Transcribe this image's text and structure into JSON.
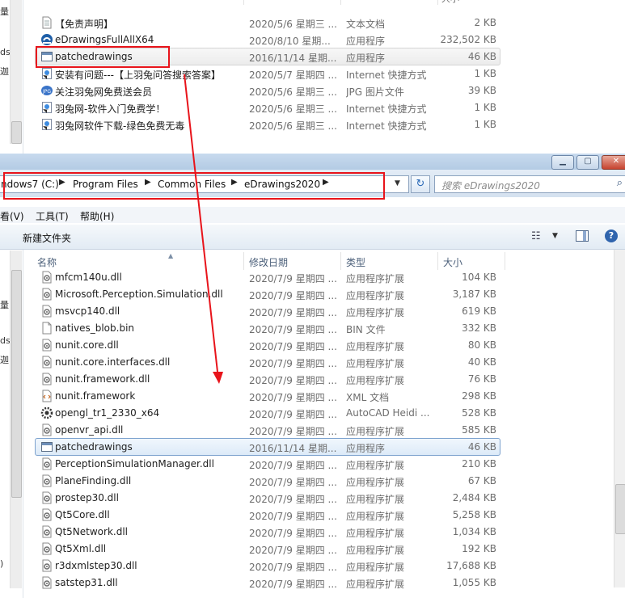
{
  "top_window": {
    "left_frag_lines": [
      "量",
      "ds",
      "迦"
    ],
    "column_header_frags": [
      "",
      "",
      "大小"
    ],
    "files": [
      {
        "name": "【免责声明】",
        "date": "2020/5/6 星期三 ...",
        "type": "文本文档",
        "size": "2 KB",
        "icon": "text-file-icon"
      },
      {
        "name": "eDrawingsFullAllX64",
        "date": "2020/8/10 星期...",
        "type": "应用程序",
        "size": "232,502 KB",
        "icon": "edrawings-app-icon"
      },
      {
        "name": "patchedrawings",
        "date": "2016/11/14 星期...",
        "type": "应用程序",
        "size": "46 KB",
        "icon": "application-icon"
      },
      {
        "name": "安装有问题---【上羽兔问答搜索答案】",
        "date": "2020/5/7 星期四 ...",
        "type": "Internet 快捷方式",
        "size": "1 KB",
        "icon": "internet-shortcut-icon"
      },
      {
        "name": "关注羽兔网免费送会员",
        "date": "2020/5/6 星期三 ...",
        "type": "JPG 图片文件",
        "size": "39 KB",
        "icon": "jpg-file-icon"
      },
      {
        "name": "羽兔网-软件入门免费学！",
        "date": "2020/5/6 星期三 ...",
        "type": "Internet 快捷方式",
        "size": "1 KB",
        "icon": "internet-shortcut-icon"
      },
      {
        "name": "羽兔网软件下载-绿色免费无毒",
        "date": "2020/5/6 星期三 ...",
        "type": "Internet 快捷方式",
        "size": "1 KB",
        "icon": "internet-shortcut-icon"
      }
    ]
  },
  "window": {
    "caption_buttons": {
      "minimize": "▁",
      "maximize": "▢",
      "close": "✕"
    },
    "breadcrumb": [
      "ndows7 (C:)",
      "Program Files",
      "Common Files",
      "eDrawings2020"
    ],
    "breadcrumb_sep": "▶",
    "dropdown_glyph": "▼",
    "refresh_glyph": "↻",
    "search_placeholder": "搜索 eDrawings2020",
    "search_glyph": "⌕",
    "menus": [
      "看(V)",
      "工具(T)",
      "帮助(H)"
    ],
    "toolbar": {
      "new_folder": "新建文件夹",
      "view_glyph": "☷",
      "caret": "▼",
      "help": "?"
    },
    "nav_frag_lines": [
      "量",
      "ds",
      "迦",
      ")"
    ],
    "columns": {
      "name": "名称",
      "date": "修改日期",
      "type": "类型",
      "size": "大小",
      "sort_glyph": "▲"
    },
    "files": [
      {
        "name": "mfcm140u.dll",
        "date": "2020/7/9 星期四 ...",
        "type": "应用程序扩展",
        "size": "104 KB",
        "icon": "dll-file-icon"
      },
      {
        "name": "Microsoft.Perception.Simulation.dll",
        "date": "2020/7/9 星期四 ...",
        "type": "应用程序扩展",
        "size": "3,187 KB",
        "icon": "dll-file-icon"
      },
      {
        "name": "msvcp140.dll",
        "date": "2020/7/9 星期四 ...",
        "type": "应用程序扩展",
        "size": "619 KB",
        "icon": "dll-file-icon"
      },
      {
        "name": "natives_blob.bin",
        "date": "2020/7/9 星期四 ...",
        "type": "BIN 文件",
        "size": "332 KB",
        "icon": "blank-file-icon"
      },
      {
        "name": "nunit.core.dll",
        "date": "2020/7/9 星期四 ...",
        "type": "应用程序扩展",
        "size": "80 KB",
        "icon": "dll-file-icon"
      },
      {
        "name": "nunit.core.interfaces.dll",
        "date": "2020/7/9 星期四 ...",
        "type": "应用程序扩展",
        "size": "40 KB",
        "icon": "dll-file-icon"
      },
      {
        "name": "nunit.framework.dll",
        "date": "2020/7/9 星期四 ...",
        "type": "应用程序扩展",
        "size": "76 KB",
        "icon": "dll-file-icon"
      },
      {
        "name": "nunit.framework",
        "date": "2020/7/9 星期四 ...",
        "type": "XML 文档",
        "size": "298 KB",
        "icon": "xml-file-icon"
      },
      {
        "name": "opengl_tr1_2330_x64",
        "date": "2020/7/9 星期四 ...",
        "type": "AutoCAD Heidi ...",
        "size": "528 KB",
        "icon": "gear-file-icon"
      },
      {
        "name": "openvr_api.dll",
        "date": "2020/7/9 星期四 ...",
        "type": "应用程序扩展",
        "size": "585 KB",
        "icon": "dll-file-icon"
      },
      {
        "name": "patchedrawings",
        "date": "2016/11/14 星期...",
        "type": "应用程序",
        "size": "46 KB",
        "icon": "application-icon"
      },
      {
        "name": "PerceptionSimulationManager.dll",
        "date": "2020/7/9 星期四 ...",
        "type": "应用程序扩展",
        "size": "210 KB",
        "icon": "dll-file-icon"
      },
      {
        "name": "PlaneFinding.dll",
        "date": "2020/7/9 星期四 ...",
        "type": "应用程序扩展",
        "size": "67 KB",
        "icon": "dll-file-icon"
      },
      {
        "name": "prostep30.dll",
        "date": "2020/7/9 星期四 ...",
        "type": "应用程序扩展",
        "size": "2,484 KB",
        "icon": "dll-file-icon"
      },
      {
        "name": "Qt5Core.dll",
        "date": "2020/7/9 星期四 ...",
        "type": "应用程序扩展",
        "size": "5,258 KB",
        "icon": "dll-file-icon"
      },
      {
        "name": "Qt5Network.dll",
        "date": "2020/7/9 星期四 ...",
        "type": "应用程序扩展",
        "size": "1,034 KB",
        "icon": "dll-file-icon"
      },
      {
        "name": "Qt5Xml.dll",
        "date": "2020/7/9 星期四 ...",
        "type": "应用程序扩展",
        "size": "192 KB",
        "icon": "dll-file-icon"
      },
      {
        "name": "r3dxmlstep30.dll",
        "date": "2020/7/9 星期四 ...",
        "type": "应用程序扩展",
        "size": "17,688 KB",
        "icon": "dll-file-icon"
      },
      {
        "name": "satstep31.dll",
        "date": "2020/7/9 星期四 ...",
        "type": "应用程序扩展",
        "size": "1,055 KB",
        "icon": "dll-file-icon"
      }
    ]
  },
  "colors": {
    "annotation_red": "#e8141b",
    "selection_blue": "#dceaf8"
  }
}
